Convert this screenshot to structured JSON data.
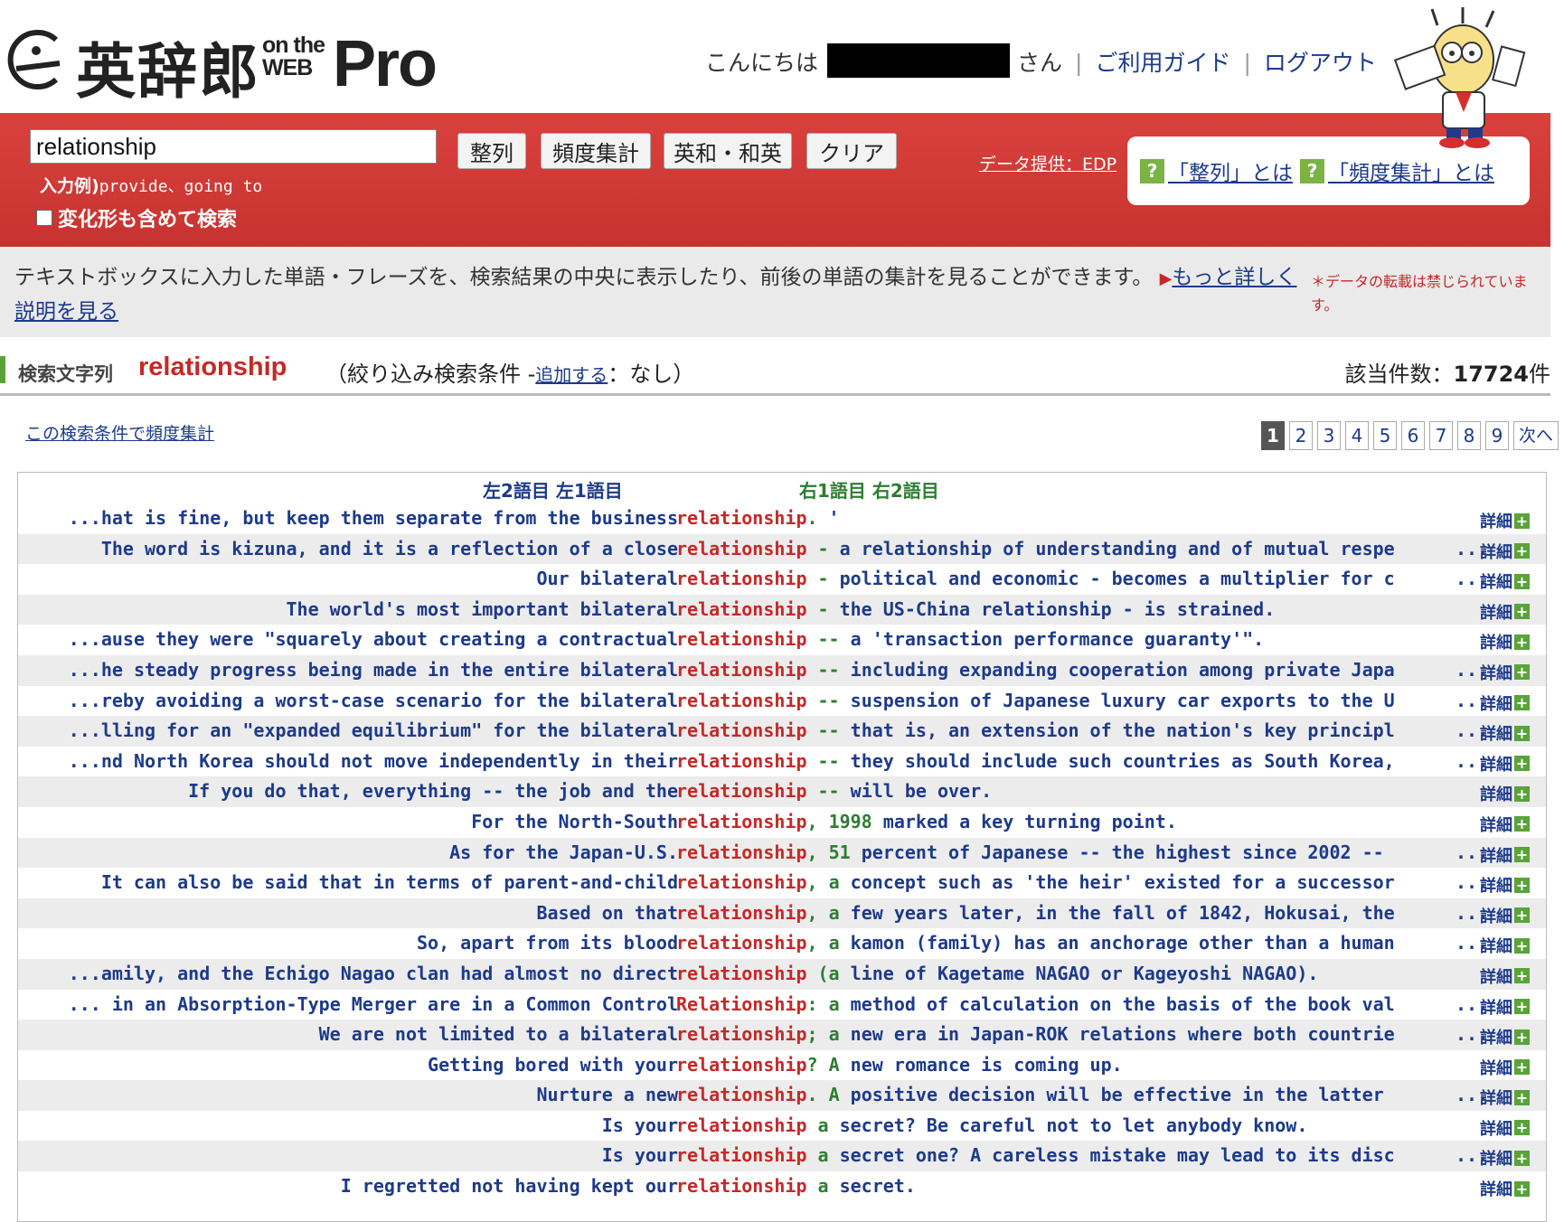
{
  "header": {
    "logo": {
      "jp": "英辞郎",
      "on_the": "on the",
      "web": "WEB",
      "pro": "Pro"
    },
    "greeting_prefix": "こんにちは",
    "greeting_suffix": "さん",
    "sep": "|",
    "guide_link": "ご利用ガイド",
    "logout_link": "ログアウト"
  },
  "search": {
    "value": "relationship",
    "buttons": [
      "整列",
      "頻度集計",
      "英和・和英",
      "クリア"
    ],
    "example_label": "入力例)",
    "example_text": "provide、going to",
    "variant_label": "変化形も含めて検索",
    "data_provider": "データ提供：EDP",
    "help_align": "「整列」とは",
    "help_freq": "「頻度集計」とは"
  },
  "description": {
    "text": "テキストボックスに入力した単語・フレーズを、検索結果の中央に表示したり、前後の単語の集計を見ることができます。",
    "more": "もっと詳しく説明を見る",
    "notice": "＊データの転載は禁じられています。"
  },
  "summary": {
    "label": "検索文字列",
    "term": "relationship",
    "cond_prefix": "（絞り込み検索条件 -",
    "cond_link": "追加する",
    "cond_suffix": "：なし）",
    "count_label": "該当件数：",
    "count_value": "17724",
    "count_unit": "件"
  },
  "freq_link": "この検索条件で頻度集計",
  "pager": {
    "pages": [
      "1",
      "2",
      "3",
      "4",
      "5",
      "6",
      "7",
      "8",
      "9"
    ],
    "current": "1",
    "next": "次へ"
  },
  "table_header": {
    "left": "左2語目  左1語目",
    "right": "右1語目  右2語目"
  },
  "detail_label": "詳細",
  "rows": [
    {
      "left": "...hat is fine, but keep them separate from the business",
      "kw": "relationship",
      "r1": ".",
      "rest": " '",
      "ell": false
    },
    {
      "left": " The word is kizuna, and it is a reflection of a close",
      "kw": "relationship",
      "r1": "-",
      "rest": " a relationship of understanding and of mutual respe",
      "ell": true
    },
    {
      "left": "Our bilateral",
      "kw": "relationship",
      "r1": "-",
      "rest": " political and economic - becomes a multiplier for c",
      "ell": true
    },
    {
      "left": "The world's most important bilateral",
      "kw": "relationship",
      "r1": "-",
      "rest": " the US-China relationship - is strained.",
      "ell": false
    },
    {
      "left": "...ause they were \"squarely about creating a contractual",
      "kw": "relationship",
      "r1": "--",
      "rest": " a 'transaction performance guaranty'\".",
      "ell": false
    },
    {
      "left": "...he steady progress being made in the entire bilateral",
      "kw": "relationship",
      "r1": "--",
      "rest": " including expanding cooperation among private Japa",
      "ell": true
    },
    {
      "left": "...reby avoiding a worst-case scenario for the bilateral",
      "kw": "relationship",
      "r1": "--",
      "rest": " suspension of Japanese luxury car exports to the U",
      "ell": true
    },
    {
      "left": "...lling for an \"expanded equilibrium\" for the bilateral",
      "kw": "relationship",
      "r1": "--",
      "rest": " that is, an extension of the nation's key principl",
      "ell": true
    },
    {
      "left": "...nd North Korea should not move independently in their",
      "kw": "relationship",
      "r1": "--",
      "rest": " they should include such countries as South Korea,",
      "ell": true
    },
    {
      "left": "If you do that, everything -- the job and the",
      "kw": "relationship",
      "r1": "--",
      "rest": " will be over.",
      "ell": false
    },
    {
      "left": "For the North-South",
      "kw": "relationship",
      "r1": ",",
      "rest": " 1998 marked a key turning point.",
      "ell": false,
      "r2green": "1998"
    },
    {
      "left": "As for the Japan-U.S.",
      "kw": "relationship",
      "r1": ",",
      "rest": " 51 percent of Japanese -- the highest since 2002 --",
      "ell": true,
      "r2green": "51"
    },
    {
      "left": " It can also be said that in terms of parent-and-child",
      "kw": "relationship",
      "r1": ",",
      "rest": " a concept such as 'the heir' existed for a successor",
      "ell": true,
      "r2green": "a"
    },
    {
      "left": "Based on that",
      "kw": "relationship",
      "r1": ",",
      "rest": " a few years later, in the fall of 1842, Hokusai, the",
      "ell": true,
      "r2green": "a"
    },
    {
      "left": "So, apart from its blood",
      "kw": "relationship",
      "r1": ",",
      "rest": " a kamon (family) has an anchorage other than a human",
      "ell": true,
      "r2green": "a"
    },
    {
      "left": "...amily, and the Echigo Nagao clan had almost no direct",
      "kw": "relationship",
      "r1": "(a",
      "rest": " line of Kagetame NAGAO or Kageyoshi NAGAO).",
      "ell": false
    },
    {
      "left": "... in an Absorption-Type Merger are in a Common Control",
      "kw": "Relationship",
      "r1": ":",
      "rest": " a method of calculation on the basis of the book val",
      "ell": true,
      "r2green": "a"
    },
    {
      "left": "We are not limited to a bilateral",
      "kw": "relationship",
      "r1": ";",
      "rest": " a new era in Japan-ROK relations where both countrie",
      "ell": true,
      "r2green": "a"
    },
    {
      "left": "Getting bored with your",
      "kw": "relationship",
      "r1": "?",
      "rest": " A new romance is coming up.",
      "ell": false,
      "r2green": "A"
    },
    {
      "left": "Nurture a new",
      "kw": "relationship",
      "r1": ".",
      "rest": " A positive decision will be effective in the latter",
      "ell": true,
      "r2green": "A"
    },
    {
      "left": "Is your",
      "kw": "relationship",
      "r1": "a",
      "rest": " secret? Be careful not to let anybody know.",
      "ell": false
    },
    {
      "left": "Is your",
      "kw": "relationship",
      "r1": "a",
      "rest": " secret one? A careless mistake may lead to its disc",
      "ell": true
    },
    {
      "left": "I regretted not having kept our",
      "kw": "relationship",
      "r1": "a",
      "rest": " secret.",
      "ell": false
    }
  ]
}
